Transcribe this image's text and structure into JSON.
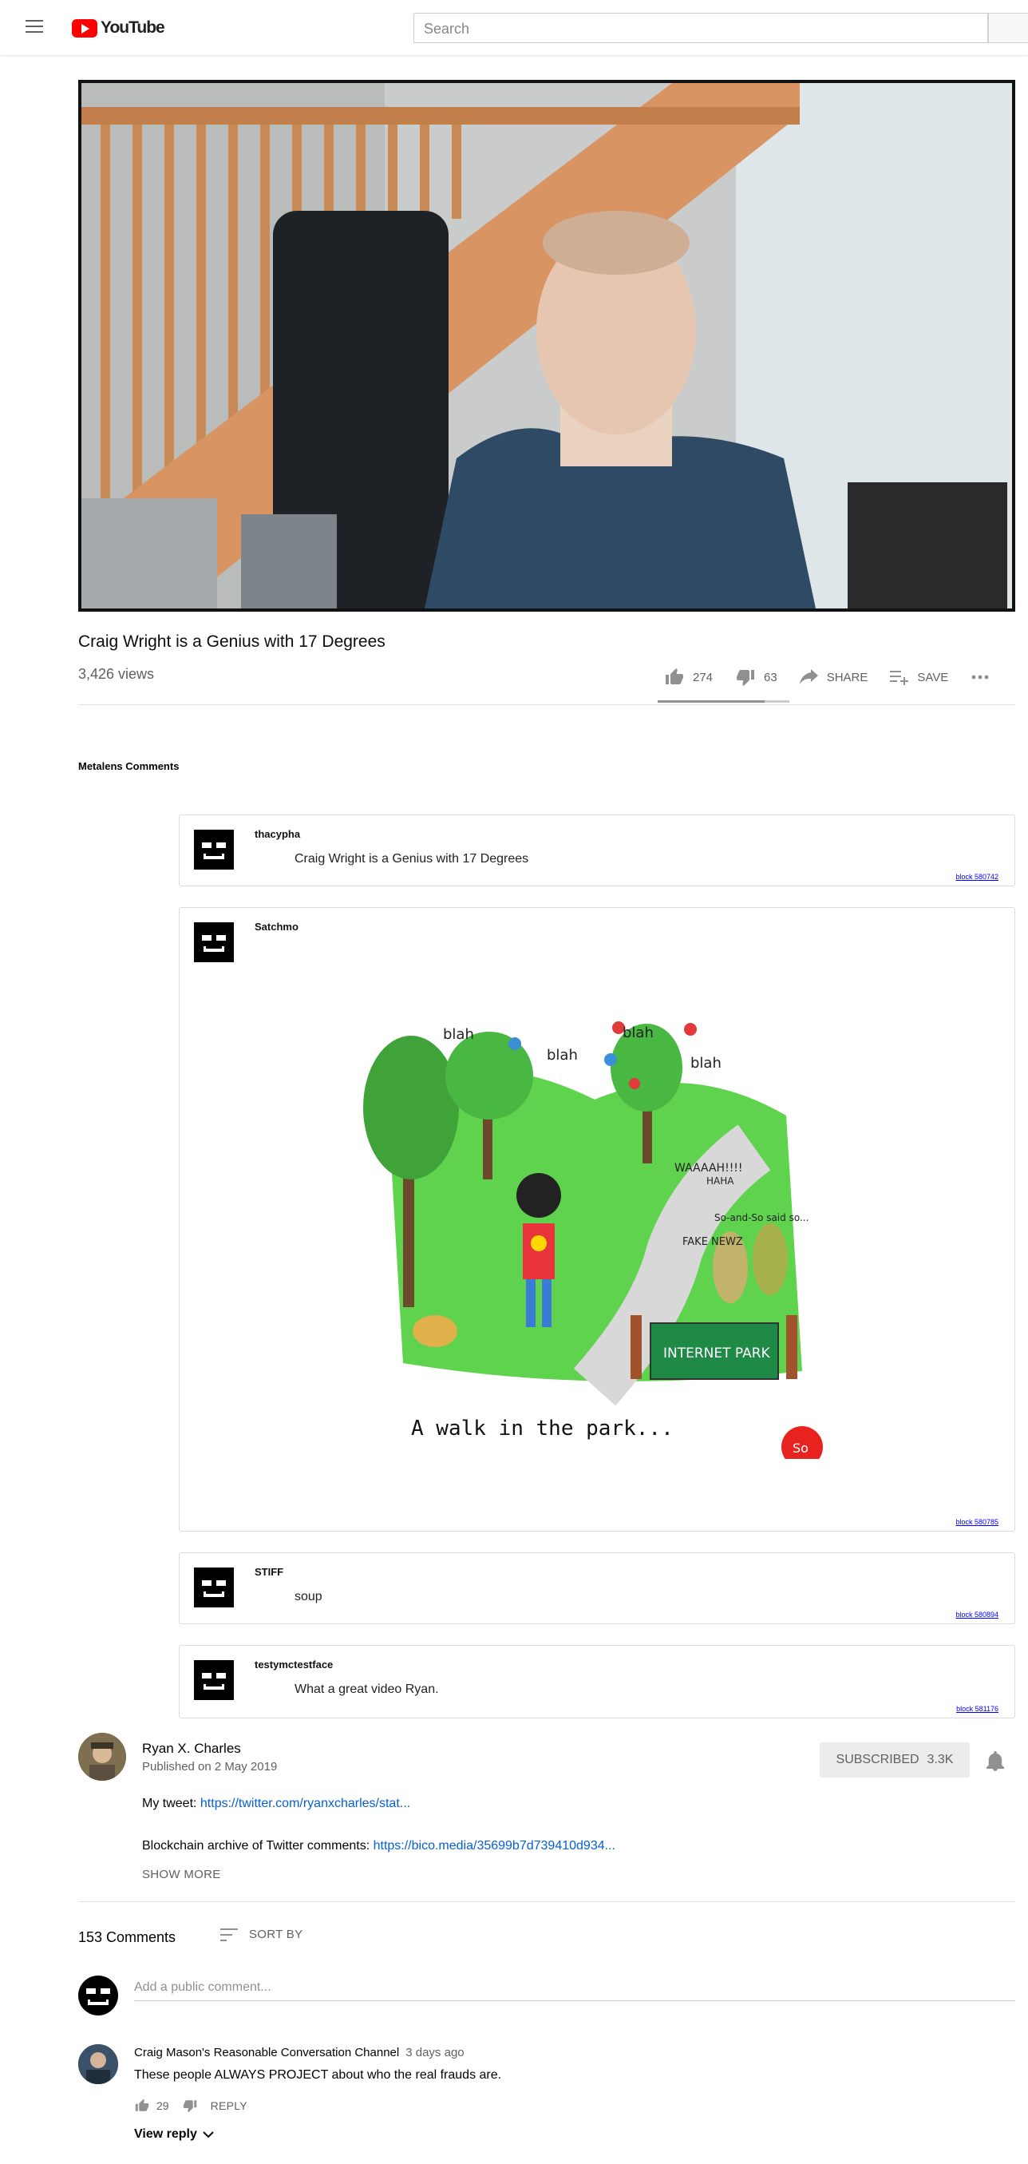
{
  "header": {
    "logo_text": "YouTube",
    "search_placeholder": "Search"
  },
  "video": {
    "title": "Craig Wright is a Genius with 17 Degrees",
    "views": "3,426 views",
    "likes": "274",
    "dislikes": "63",
    "share_label": "SHARE",
    "save_label": "SAVE",
    "like_ratio": 0.81
  },
  "metalens": {
    "heading": "Metalens Comments",
    "comments": [
      {
        "user": "thacypha",
        "text": "Craig Wright is a Genius with 17 Degrees",
        "block": "block 580742"
      },
      {
        "user": "Satchmo",
        "text": "",
        "block": "block 580785"
      },
      {
        "user": "STIFF",
        "text": "soup",
        "block": "block 580894"
      },
      {
        "user": "testymctestface",
        "text": "What a great video Ryan.",
        "block": "block 581176"
      }
    ],
    "cartoon": {
      "blah1": "blah",
      "blah2": "blah",
      "blah3": "blah",
      "blah4": "blah",
      "waah": "WAAAAH!!!!",
      "haha": "HAHA",
      "soandso": "So-and-So said so...",
      "fakenews": "FAKE NEWZ",
      "sign": "INTERNET PARK",
      "caption": "A walk in the park...",
      "signature": "So"
    }
  },
  "channel": {
    "name": "Ryan X. Charles",
    "published": "Published on 2 May 2019",
    "subscribe_label": "SUBSCRIBED",
    "subscriber_count": "3.3K",
    "tweet_prefix": "My tweet: ",
    "tweet_link": "https://twitter.com/ryanxcharles/stat...",
    "archive_prefix": "Blockchain archive of Twitter comments: ",
    "archive_link": "https://bico.media/35699b7d739410d934...",
    "show_more": "SHOW MORE"
  },
  "comments": {
    "count_label": "153 Comments",
    "sort_label": "SORT BY",
    "add_placeholder": "Add a public comment...",
    "items": [
      {
        "author": "Craig Mason's Reasonable Conversation Channel",
        "time": "3 days ago",
        "text": "These people ALWAYS PROJECT about who the real frauds are.",
        "likes": "29",
        "reply_label": "REPLY",
        "view_reply": "View reply"
      }
    ]
  }
}
